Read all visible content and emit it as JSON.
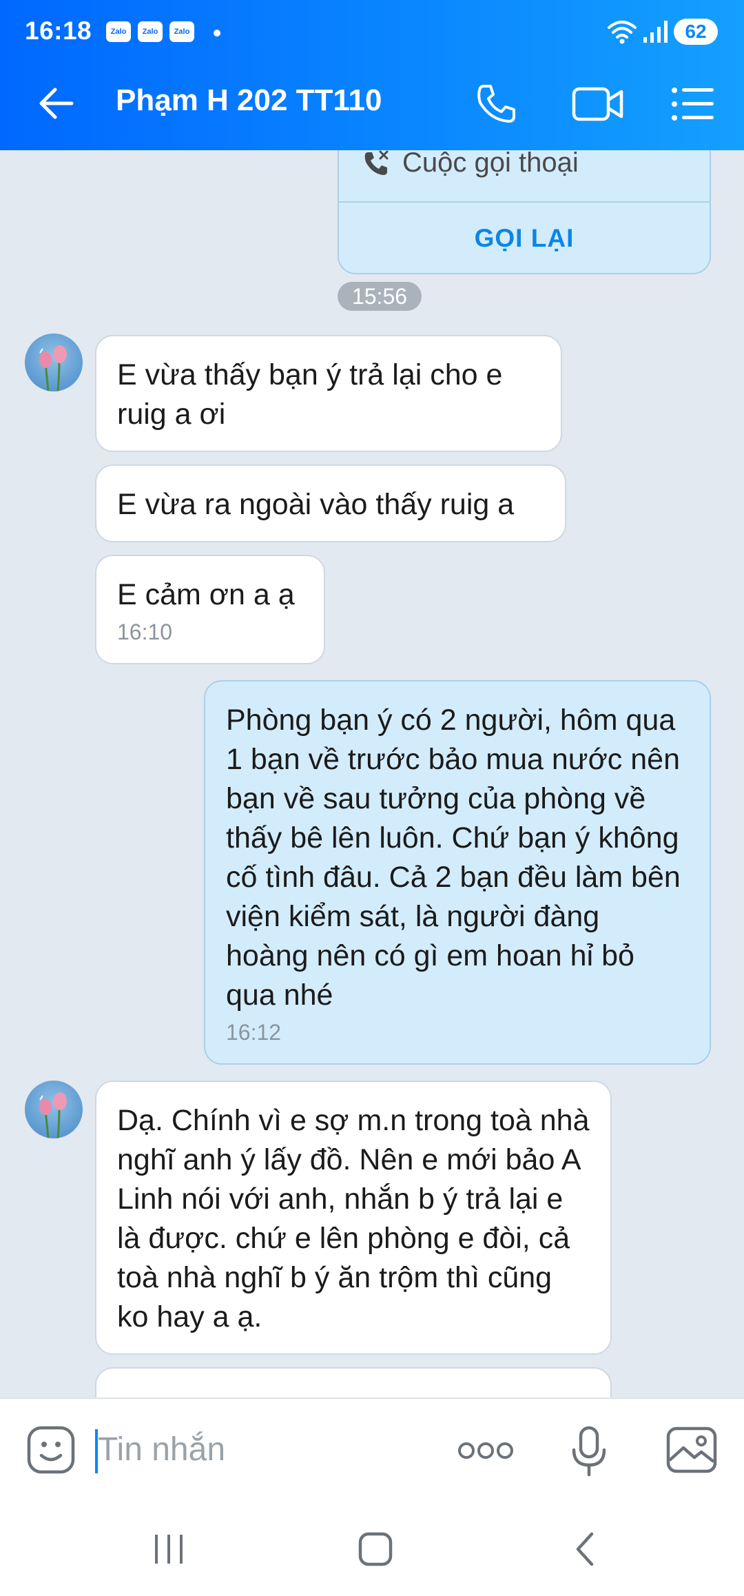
{
  "status_bar": {
    "time": "16:18",
    "notification_badges": [
      "Zalo",
      "Zalo",
      "Zalo"
    ],
    "battery": "62"
  },
  "header": {
    "contact_name": "Phạm H 202 TT110",
    "back_icon": "arrow-left-icon",
    "call_icon": "phone-icon",
    "video_icon": "video-camera-icon",
    "menu_icon": "menu-list-icon"
  },
  "call_card": {
    "label": "Cuộc gọi thoại",
    "callback_label": "GỌI LẠI"
  },
  "time_chip": "15:56",
  "messages": [
    {
      "from": "contact",
      "text": "E vừa thấy bạn ý trả lại cho e ruig a ơi",
      "time": ""
    },
    {
      "from": "contact",
      "text": "E vừa ra ngoài vào thấy ruig a",
      "time": ""
    },
    {
      "from": "contact",
      "text": "E cảm ơn a ạ",
      "time": "16:10"
    },
    {
      "from": "me",
      "text": "Phòng bạn ý có 2 người, hôm qua 1 bạn về trước bảo mua nước nên bạn về sau tưởng của phòng về thấy bê lên luôn. Chứ bạn ý không cố tình đâu. Cả 2 bạn đều làm bên viện kiểm sát, là người đàng hoàng nên có gì em hoan hỉ bỏ qua nhé",
      "time": "16:12"
    },
    {
      "from": "contact",
      "text": "Dạ. Chính vì e sợ m.n trong toà nhà nghĩ anh ý lấy đồ. Nên e mới bảo A Linh nói với anh, nhắn b ý trả lại e là được. chứ e lên phòng e đòi, cả toà nhà nghĩ b ý ăn trộm thì cũng ko hay a ạ.",
      "time": ""
    }
  ],
  "input": {
    "placeholder": "Tin nhắn"
  },
  "colors": {
    "header_gradient_start": "#0068ff",
    "header_gradient_end": "#14a0ff",
    "my_bubble": "#d3ecfc",
    "contact_bubble": "#ffffff",
    "chat_background": "#e2e9f1",
    "accent": "#0a86e8"
  }
}
